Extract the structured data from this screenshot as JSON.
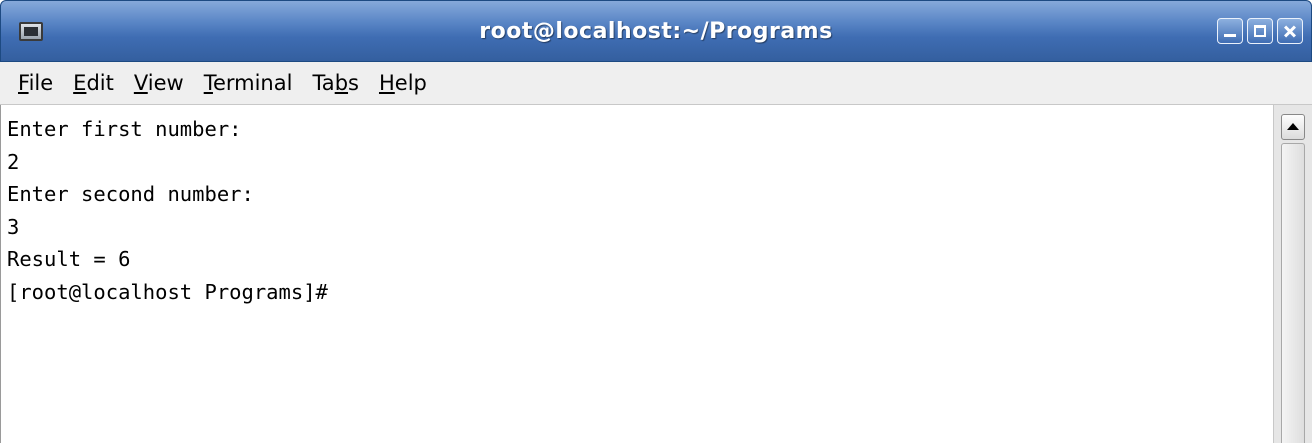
{
  "window": {
    "title": "root@localhost:~/Programs",
    "icon": "terminal-icon"
  },
  "window_controls": {
    "minimize_icon": "minimize-icon",
    "maximize_icon": "maximize-icon",
    "close_icon": "close-icon"
  },
  "menu": {
    "items": [
      {
        "before": "",
        "mnemonic": "F",
        "after": "ile"
      },
      {
        "before": "",
        "mnemonic": "E",
        "after": "dit"
      },
      {
        "before": "",
        "mnemonic": "V",
        "after": "iew"
      },
      {
        "before": "",
        "mnemonic": "T",
        "after": "erminal"
      },
      {
        "before": "Ta",
        "mnemonic": "b",
        "after": "s"
      },
      {
        "before": "",
        "mnemonic": "H",
        "after": "elp"
      }
    ]
  },
  "terminal": {
    "lines": [
      "Enter first number:",
      "2",
      "Enter second number:",
      "3",
      "Result = 6",
      "[root@localhost Programs]#"
    ]
  },
  "scrollbar": {
    "up_arrow_icon": "arrow-up-icon"
  },
  "colors": {
    "titlebar": "#4a77bb",
    "menubar": "#efefef",
    "terminal_bg": "#ffffff",
    "terminal_fg": "#000000"
  }
}
